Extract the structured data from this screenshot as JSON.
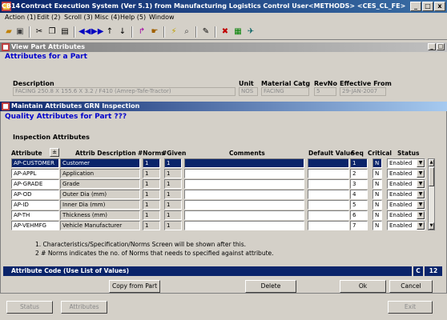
{
  "window": {
    "icon_text": "CB14",
    "title": "Contract Execution System (Ver 5.1) from Manufacturing Logistics Control  User<METHODS>  <CES_CL_FE>",
    "minimize": "_",
    "maximize": "□",
    "close": "x"
  },
  "menu": [
    "Action (1)",
    "Edit (2)",
    "Scroll (3)",
    "Misc (4)",
    "Help (5)",
    "Window"
  ],
  "view_panel": {
    "title": "View Part Attributes",
    "heading": "Attributes for a Part",
    "labels": {
      "description": "Description",
      "unit": "Unit",
      "material_catg": "Material Catg",
      "revno": "RevNo",
      "effective_from": "Effective From"
    },
    "values": {
      "description": "FACING 250.8 X 155.6 X 3.2 / F410 (Amrep-Tafe-Tractor)",
      "unit": "NOS",
      "material_catg": "FACING",
      "revno": "5",
      "effective_from": "29-JAN-2007"
    }
  },
  "maint_panel": {
    "title": "Maintain Attributes GRN Inspection",
    "heading": "Quality Attributes for Part ???",
    "section": "Inspection Attributes",
    "columns": {
      "attribute": "Attribute",
      "sort": "±",
      "desc": "Attrib Description",
      "norms": "#Norms",
      "given": "#Given",
      "comments": "Comments",
      "default_value": "Default Value",
      "seq": "Seq",
      "critical": "Critical",
      "status": "Status"
    },
    "rows": [
      {
        "attribute": "AP-CUSTOMER",
        "desc": "Customer",
        "norms": "1",
        "given": "1",
        "comments": "",
        "default": "",
        "seq": "1",
        "critical": "N",
        "status": "Enabled"
      },
      {
        "attribute": "AP-APPL",
        "desc": "Application",
        "norms": "1",
        "given": "1",
        "comments": "",
        "default": "",
        "seq": "2",
        "critical": "N",
        "status": "Enabled"
      },
      {
        "attribute": "AP-GRADE",
        "desc": "Grade",
        "norms": "1",
        "given": "1",
        "comments": "",
        "default": "",
        "seq": "3",
        "critical": "N",
        "status": "Enabled"
      },
      {
        "attribute": "AP-OD",
        "desc": "Outer Dia (mm)",
        "norms": "1",
        "given": "1",
        "comments": "",
        "default": "",
        "seq": "4",
        "critical": "N",
        "status": "Enabled"
      },
      {
        "attribute": "AP-ID",
        "desc": "Inner Dia (mm)",
        "norms": "1",
        "given": "1",
        "comments": "",
        "default": "",
        "seq": "5",
        "critical": "N",
        "status": "Enabled"
      },
      {
        "attribute": "AP-TH",
        "desc": "Thickness (mm)",
        "norms": "1",
        "given": "1",
        "comments": "",
        "default": "",
        "seq": "6",
        "critical": "N",
        "status": "Enabled"
      },
      {
        "attribute": "AP-VEHMFG",
        "desc": "Vehicle Manufacturer",
        "norms": "1",
        "given": "1",
        "comments": "",
        "default": "",
        "seq": "7",
        "critical": "N",
        "status": "Enabled"
      }
    ],
    "notes": [
      "1. Characteristics/Specification/Norms Screen will be shown after this.",
      "2 # Norms indicates the no. of Norms that needs to specified against attribute."
    ],
    "status_text": "Attribute Code (Use List of Values)",
    "status_mode": "C",
    "status_num": "12",
    "buttons": {
      "copy": "Copy from Part",
      "delete": "Delete",
      "ok": "Ok",
      "cancel": "Cancel"
    }
  },
  "bottom_buttons": {
    "status": "Status",
    "attributes": "Attributes",
    "exit": "Exit"
  }
}
